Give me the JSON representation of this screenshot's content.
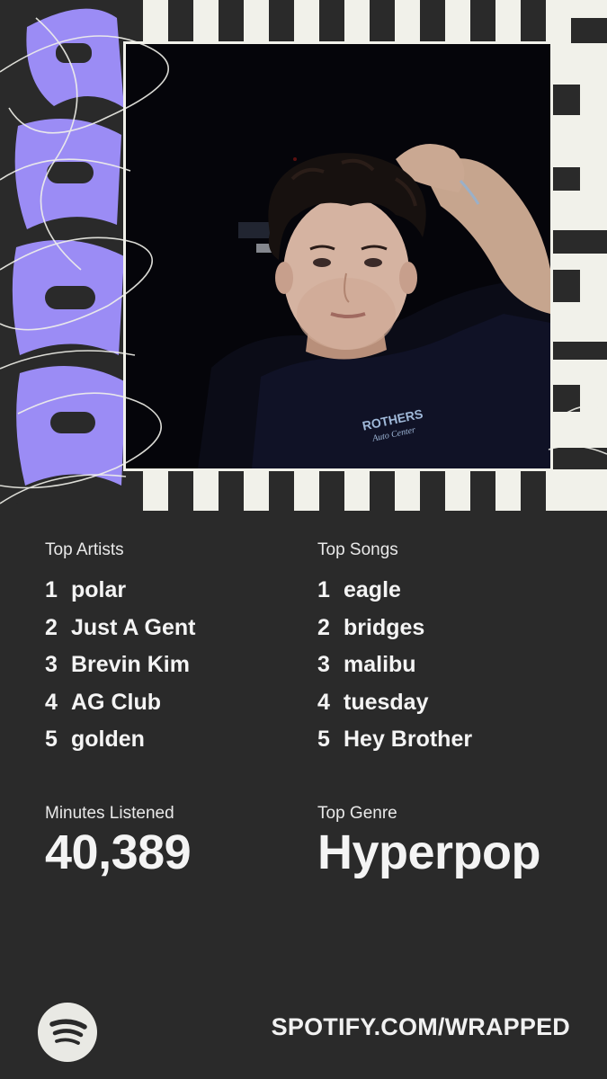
{
  "year_badge": "2025",
  "top_artists": {
    "label": "Top Artists",
    "items": [
      {
        "rank": "1",
        "name": "polar"
      },
      {
        "rank": "2",
        "name": "Just A Gent"
      },
      {
        "rank": "3",
        "name": "Brevin Kim"
      },
      {
        "rank": "4",
        "name": "AG Club"
      },
      {
        "rank": "5",
        "name": "golden"
      }
    ]
  },
  "top_songs": {
    "label": "Top Songs",
    "items": [
      {
        "rank": "1",
        "name": "eagle"
      },
      {
        "rank": "2",
        "name": "bridges"
      },
      {
        "rank": "3",
        "name": "malibu"
      },
      {
        "rank": "4",
        "name": "tuesday"
      },
      {
        "rank": "5",
        "name": "Hey Brother"
      }
    ]
  },
  "minutes": {
    "label": "Minutes Listened",
    "value": "40,389"
  },
  "genre": {
    "label": "Top Genre",
    "value": "Hyperpop"
  },
  "footer": {
    "url": "SPOTIFY.COM/WRAPPED",
    "logo_icon": "spotify-logo-icon"
  },
  "colors": {
    "background": "#2a2a2a",
    "accent": "#9b8cf5",
    "stripe_light": "#f1f1ea",
    "text": "#f1f1f1"
  }
}
